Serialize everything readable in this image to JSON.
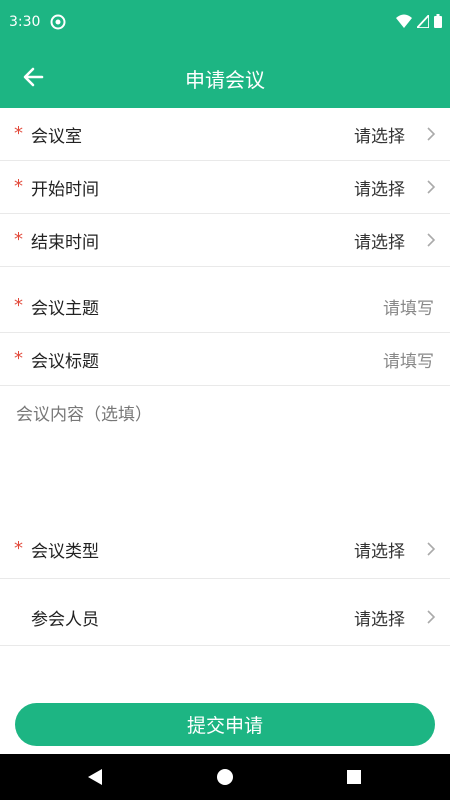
{
  "status": {
    "time": "3:30"
  },
  "appbar": {
    "title": "申请会议"
  },
  "form": {
    "required_mark": "*",
    "room": {
      "label": "会议室",
      "value": "请选择"
    },
    "start_time": {
      "label": "开始时间",
      "value": "请选择"
    },
    "end_time": {
      "label": "结束时间",
      "value": "请选择"
    },
    "topic": {
      "label": "会议主题",
      "value": "请填写"
    },
    "subject_title": {
      "label": "会议标题",
      "value": "请填写"
    },
    "content": {
      "placeholder": "会议内容（选填）"
    },
    "type": {
      "label": "会议类型",
      "value": "请选择"
    },
    "attendees": {
      "label": "参会人员",
      "value": "请选择"
    }
  },
  "submit": {
    "label": "提交申请"
  },
  "colors": {
    "brand": "#1db583",
    "required": "#e24a3b"
  }
}
